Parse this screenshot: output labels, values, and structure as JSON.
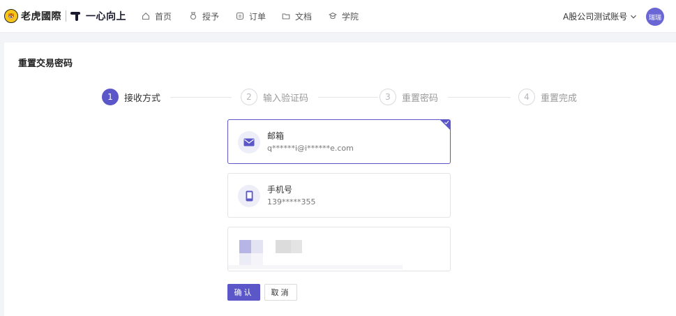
{
  "header": {
    "brand_name": "老虎國際",
    "brand_badge": "tiger-logo",
    "slogan": "一心向上",
    "nav": [
      {
        "label": "首页",
        "icon": "home-icon"
      },
      {
        "label": "授予",
        "icon": "medal-icon"
      },
      {
        "label": "订单",
        "icon": "order-icon"
      },
      {
        "label": "文档",
        "icon": "folder-icon"
      },
      {
        "label": "学院",
        "icon": "academy-icon"
      }
    ],
    "account_label": "A股公司测试账号",
    "avatar_text": "瑞瑞"
  },
  "page": {
    "title": "重置交易密码"
  },
  "steps": [
    {
      "num": "1",
      "label": "接收方式",
      "active": true
    },
    {
      "num": "2",
      "label": "输入验证码",
      "active": false
    },
    {
      "num": "3",
      "label": "重置密码",
      "active": false
    },
    {
      "num": "4",
      "label": "重置完成",
      "active": false
    }
  ],
  "options": [
    {
      "title": "邮箱",
      "value": "q******i@i******e.com",
      "icon": "mail-icon",
      "selected": true
    },
    {
      "title": "手机号",
      "value": "139*****355",
      "icon": "phone-icon",
      "selected": false
    }
  ],
  "buttons": {
    "confirm": "确认",
    "cancel": "取消"
  },
  "colors": {
    "accent": "#5b57c8"
  }
}
